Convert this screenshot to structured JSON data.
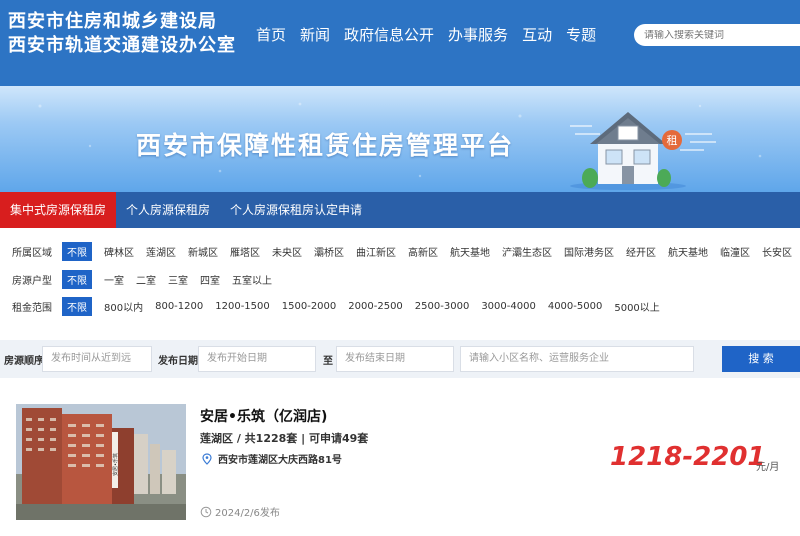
{
  "header": {
    "brand_line1": "西安市住房和城乡建设局",
    "brand_line2": "西安市轨道交通建设办公室",
    "nav": [
      "首页",
      "新闻",
      "政府信息公开",
      "办事服务",
      "互动",
      "专题"
    ],
    "search_placeholder": "请输入搜索关键词"
  },
  "banner": {
    "title": "西安市保障性租赁住房管理平台",
    "house_badge": "租"
  },
  "tabs": [
    "集中式房源保租房",
    "个人房源保租房",
    "个人房源保租房认定申请"
  ],
  "filters": {
    "district": {
      "label": "所属区域",
      "selected": "不限",
      "options": [
        "碑林区",
        "莲湖区",
        "新城区",
        "雁塔区",
        "未央区",
        "灞桥区",
        "曲江新区",
        "高新区",
        "航天基地",
        "浐灞生态区",
        "国际港务区",
        "经开区",
        "航天基地",
        "临潼区",
        "长安区"
      ]
    },
    "layout": {
      "label": "房源户型",
      "selected": "不限",
      "options": [
        "一室",
        "二室",
        "三室",
        "四室",
        "五室以上"
      ]
    },
    "rent": {
      "label": "租金范围",
      "selected": "不限",
      "options": [
        "800以内",
        "800-1200",
        "1200-1500",
        "1500-2000",
        "2000-2500",
        "2500-3000",
        "3000-4000",
        "4000-5000",
        "5000以上"
      ]
    }
  },
  "search": {
    "order_label": "房源顺序",
    "order_value": "发布时间从近到远",
    "date_label": "发布日期",
    "date_start_placeholder": "发布开始日期",
    "to_label": "至",
    "date_end_placeholder": "发布结束日期",
    "keyword_placeholder": "请输入小区名称、运营服务企业",
    "button": "搜 索"
  },
  "listing": {
    "title": "安居•乐筑（亿润店)",
    "meta": "莲湖区  / 共1228套 | 可申请49套",
    "address": "西安市莲湖区大庆西路81号",
    "date": "2024/2/6发布",
    "price": "1218-2201",
    "unit": "元/月",
    "photo_sign": "安居•乐筑"
  },
  "colors": {
    "header_blue": "#2d74c4",
    "tab_bar": "#2a5fa8",
    "tab_active": "#d81e1e",
    "filter_selected": "#1f64c7",
    "price_red": "#e03030"
  }
}
